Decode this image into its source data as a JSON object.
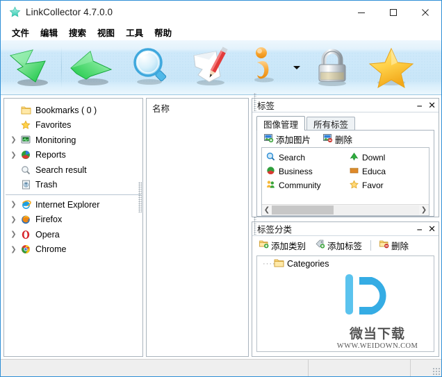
{
  "window": {
    "title": "LinkCollector 4.7.0.0",
    "app_icon": "star-icon",
    "minimize": "—",
    "maximize": "☐",
    "close": "✕"
  },
  "menubar": {
    "items": [
      {
        "label": "文件",
        "name": "menu-file"
      },
      {
        "label": "编辑",
        "name": "menu-edit"
      },
      {
        "label": "搜索",
        "name": "menu-search"
      },
      {
        "label": "视图",
        "name": "menu-view"
      },
      {
        "label": "工具",
        "name": "menu-tools"
      },
      {
        "label": "帮助",
        "name": "menu-help"
      }
    ]
  },
  "toolbar": {
    "buttons": [
      {
        "name": "import-down-arrow-icon",
        "icon": "green-down-arrow"
      },
      {
        "name": "export-up-arrow-icon",
        "icon": "green-up-arrow"
      },
      {
        "name": "search-magnifier-icon",
        "icon": "magnifier"
      },
      {
        "name": "edit-pencil-icon",
        "icon": "pencil-paper"
      },
      {
        "name": "info-icon",
        "icon": "orange-info"
      },
      {
        "name": "lock-icon",
        "icon": "padlock"
      },
      {
        "name": "favorites-star-icon",
        "icon": "yellow-star"
      }
    ],
    "dropdown_caret": "▼"
  },
  "tree": {
    "items": [
      {
        "label": "Bookmarks ( 0 )",
        "icon": "folder-icon",
        "expandable": false,
        "name": "tree-item-bookmarks"
      },
      {
        "label": "Favorites",
        "icon": "star-icon",
        "expandable": false,
        "name": "tree-item-favorites"
      },
      {
        "label": "Monitoring",
        "icon": "monitor-icon",
        "expandable": true,
        "name": "tree-item-monitoring"
      },
      {
        "label": "Reports",
        "icon": "pie-chart-icon",
        "expandable": true,
        "name": "tree-item-reports"
      },
      {
        "label": "Search result",
        "icon": "magnifier-icon",
        "expandable": false,
        "name": "tree-item-search-result"
      },
      {
        "label": "Trash",
        "icon": "trash-icon",
        "expandable": false,
        "name": "tree-item-trash"
      },
      {
        "label": "Internet Explorer",
        "icon": "ie-icon",
        "expandable": true,
        "name": "tree-item-internet-explorer"
      },
      {
        "label": "Firefox",
        "icon": "firefox-icon",
        "expandable": true,
        "name": "tree-item-firefox"
      },
      {
        "label": "Opera",
        "icon": "opera-icon",
        "expandable": true,
        "name": "tree-item-opera"
      },
      {
        "label": "Chrome",
        "icon": "chrome-icon",
        "expandable": true,
        "name": "tree-item-chrome"
      }
    ],
    "divider_after_index": 5,
    "expander_glyph": "❯"
  },
  "list_panel": {
    "column_header": "名称",
    "rows": []
  },
  "tags_panel": {
    "title": "标签",
    "minimize": "‒",
    "close": "✕",
    "tabs": [
      {
        "label": "图像管理",
        "active": true,
        "name": "tab-image-management"
      },
      {
        "label": "所有标签",
        "active": false,
        "name": "tab-all-tags"
      }
    ],
    "buttons": [
      {
        "label": "添加图片",
        "icon": "add-image-icon",
        "name": "add-image-button"
      },
      {
        "label": "删除",
        "icon": "delete-image-icon",
        "name": "delete-image-button"
      }
    ],
    "left_column": [
      {
        "label": "Search",
        "icon": "magnifier-icon"
      },
      {
        "label": "Business",
        "icon": "pie-chart-icon"
      },
      {
        "label": "Community",
        "icon": "people-icon"
      }
    ],
    "right_column": [
      {
        "label": "Downl",
        "icon": "green-arrow-icon"
      },
      {
        "label": "Educa",
        "icon": "book-icon"
      },
      {
        "label": "Favor",
        "icon": "star-icon"
      }
    ],
    "scroll_left": "❮",
    "scroll_right": "❯",
    "scroll_thumb_pct": 42
  },
  "tag_category_panel": {
    "title": "标签分类",
    "minimize": "‒",
    "close": "✕",
    "buttons": [
      {
        "label": "添加类别",
        "icon": "add-category-icon",
        "name": "add-category-button"
      },
      {
        "label": "添加标签",
        "icon": "add-tag-icon",
        "name": "add-tag-button"
      },
      {
        "label": "删除",
        "icon": "delete-icon",
        "name": "delete-category-button"
      }
    ],
    "tree": [
      {
        "label": "Categories",
        "icon": "folder-icon",
        "name": "category-root"
      }
    ]
  },
  "watermark": {
    "logo": "D-logo",
    "text_cn": "微当下载",
    "text_en": "WWW.WEIDOWN.COM"
  },
  "statusbar": {
    "segments": [
      "",
      "",
      ""
    ]
  },
  "colors": {
    "window_border": "#2f8fd6",
    "toolbar_top": "#eef7fd",
    "toolbar_mid": "#c9e6f8",
    "accent": "#2f8fd6",
    "watermark": "#3fb3e8"
  }
}
